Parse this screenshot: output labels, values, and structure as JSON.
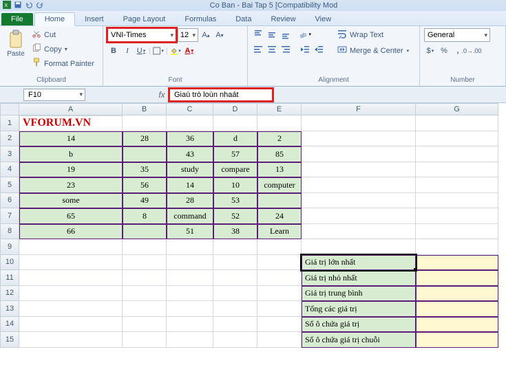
{
  "titlebar": {
    "title": "Co Ban - Bai Tap 5  [Compatibility Mod"
  },
  "tabs": {
    "file": "File",
    "home": "Home",
    "insert": "Insert",
    "pagelayout": "Page Layout",
    "formulas": "Formulas",
    "data": "Data",
    "review": "Review",
    "view": "View"
  },
  "clipboard": {
    "paste": "Paste",
    "cut": "Cut",
    "copy": "Copy",
    "painter": "Format Painter",
    "label": "Clipboard"
  },
  "font": {
    "name": "VNI-Times",
    "size": "12",
    "label": "Font"
  },
  "alignment": {
    "wrap": "Wrap Text",
    "merge": "Merge & Center",
    "label": "Alignment"
  },
  "number": {
    "format": "General",
    "label": "Number"
  },
  "fbar": {
    "name": "F10",
    "formula": "Giaù trò loùn nhaát"
  },
  "cols": [
    "A",
    "B",
    "C",
    "D",
    "E",
    "F",
    "G"
  ],
  "brand": "VFORUM.VN",
  "chart_data": {
    "type": "table",
    "title": "",
    "range": "A2:E8",
    "columns": [
      "A",
      "B",
      "C",
      "D",
      "E"
    ],
    "rows": [
      [
        14,
        28,
        36,
        "d",
        2
      ],
      [
        "b",
        "",
        43,
        57,
        85
      ],
      [
        19,
        35,
        "study",
        "compare",
        13
      ],
      [
        23,
        56,
        14,
        10,
        "computer"
      ],
      [
        "some",
        49,
        28,
        53,
        ""
      ],
      [
        65,
        8,
        "command",
        52,
        24
      ],
      [
        66,
        "",
        51,
        38,
        "Learn"
      ]
    ]
  },
  "labels": [
    "Giá trị lớn nhất",
    "Giá trị nhỏ nhất",
    "Giá trị trung bình",
    "Tổng các giá trị",
    "Số ô chứa giá trị",
    "Số ô chứa giá trị chuỗi"
  ]
}
